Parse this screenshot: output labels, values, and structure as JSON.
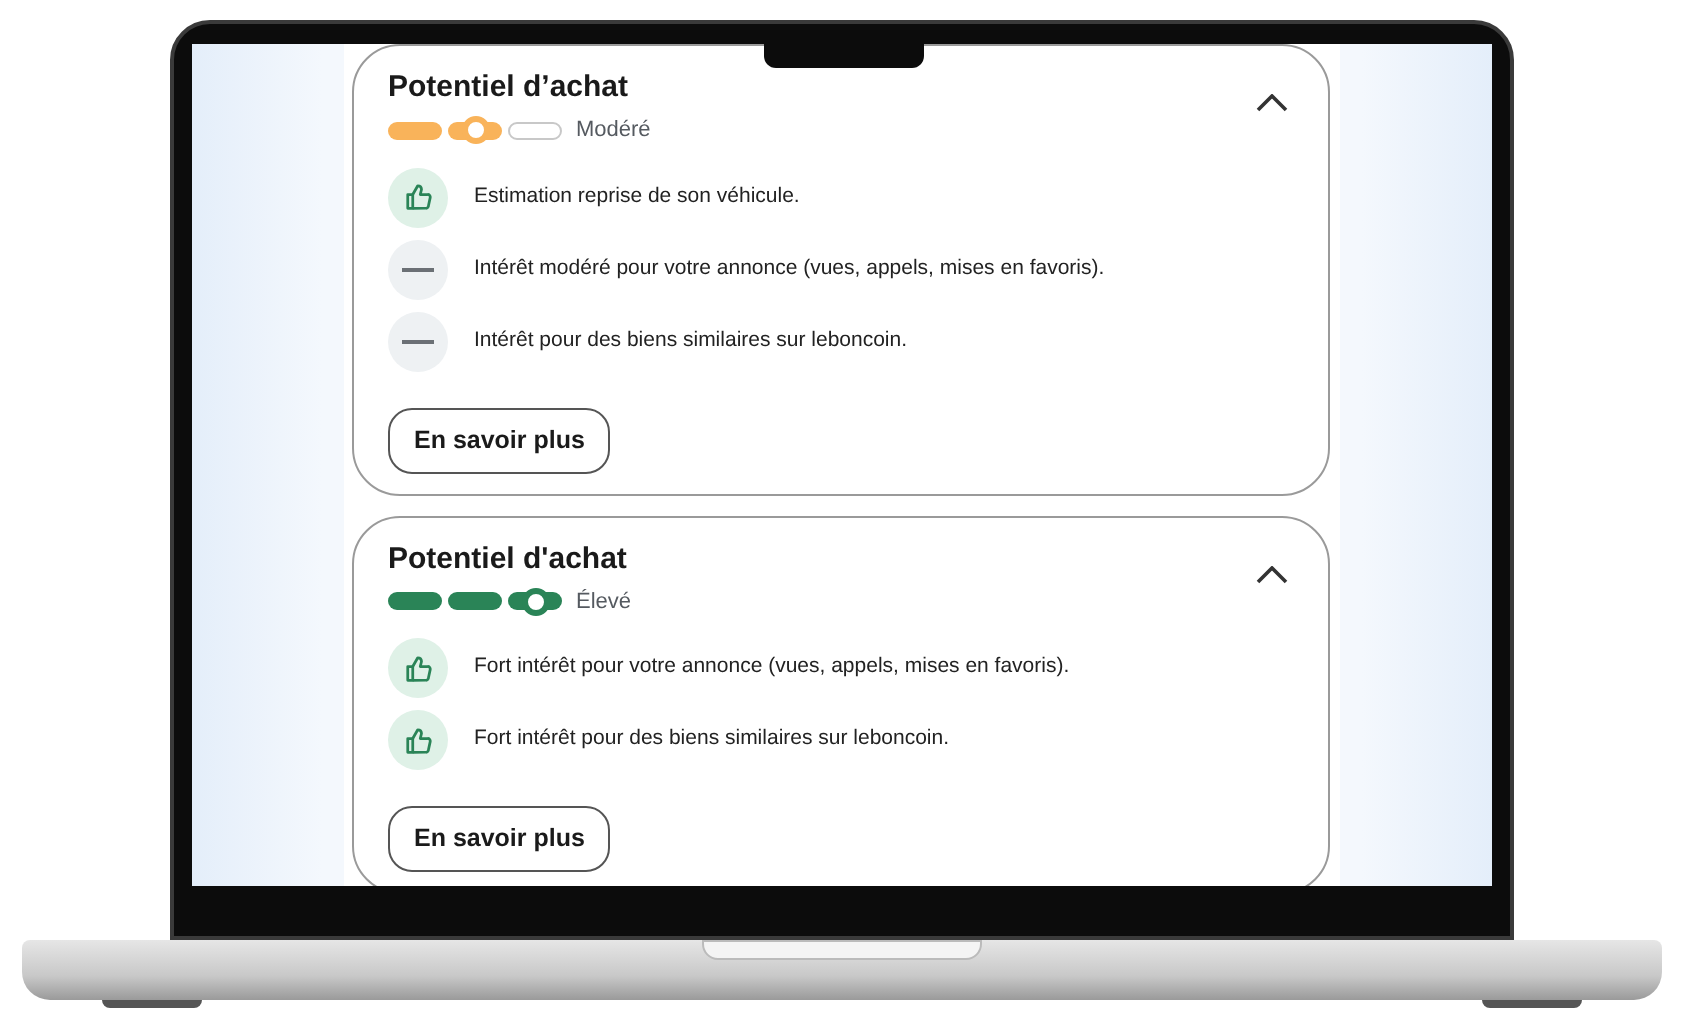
{
  "cards": [
    {
      "title": "Potentiel d’achat",
      "segments": [
        {
          "filled": true,
          "selected": false
        },
        {
          "filled": true,
          "selected": true
        },
        {
          "filled": false,
          "selected": false
        }
      ],
      "color": "#f9b35a",
      "rating": "Modéré",
      "expanded": true,
      "items": [
        {
          "kind": "positive",
          "text": "Estimation reprise de son véhicule."
        },
        {
          "kind": "neutral",
          "text": "Intérêt modéré pour votre annonce (vues, appels, mises en favoris)."
        },
        {
          "kind": "neutral",
          "text": "Intérêt pour des biens similaires sur leboncoin."
        }
      ],
      "button": "En savoir plus"
    },
    {
      "title": "Potentiel d'achat",
      "segments": [
        {
          "filled": true,
          "selected": false
        },
        {
          "filled": true,
          "selected": false
        },
        {
          "filled": true,
          "selected": true
        }
      ],
      "color": "#2a8457",
      "rating": "Élevé",
      "expanded": true,
      "items": [
        {
          "kind": "positive",
          "text": "Fort intérêt pour votre annonce (vues, appels, mises en favoris)."
        },
        {
          "kind": "positive",
          "text": "Fort intérêt pour des biens similaires sur leboncoin."
        }
      ],
      "button": "En savoir plus"
    }
  ]
}
